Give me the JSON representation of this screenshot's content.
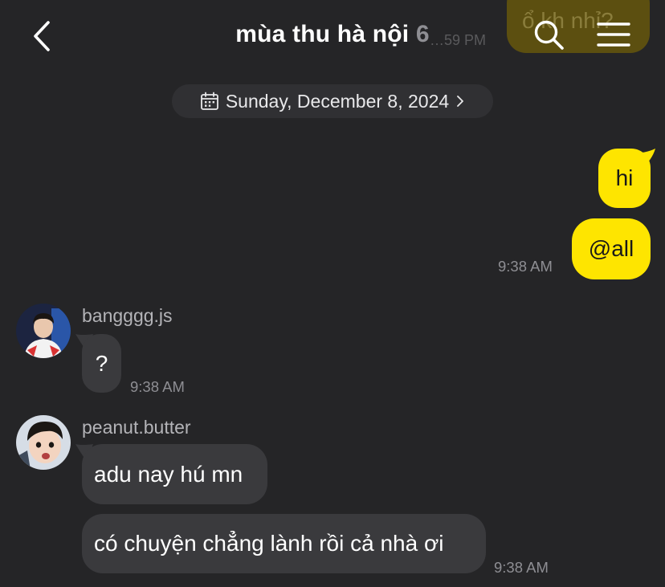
{
  "previous": {
    "text": "ổ kh nhỉ?",
    "time": "…59 PM"
  },
  "header": {
    "title": "mùa thu hà nội",
    "member_count": "6"
  },
  "date_divider": {
    "label": "Sunday, December 8, 2024"
  },
  "messages": [
    {
      "from": "me",
      "text": "hi"
    },
    {
      "from": "me",
      "text": "@all",
      "time": "9:38 AM"
    },
    {
      "from": "bangggg.js",
      "text": "?",
      "time": "9:38 AM"
    },
    {
      "from": "peanut.butter",
      "text": "adu nay hú mn"
    },
    {
      "from": "peanut.butter",
      "text": "có chuyện chẳng lành rồi cả nhà ơi",
      "time": "9:38 AM"
    }
  ],
  "colors": {
    "background": "#252527",
    "my_bubble": "#fee500",
    "their_bubble": "#3a3a3d",
    "date_pill": "#303033"
  },
  "icons": [
    "back-arrow-icon",
    "search-icon",
    "menu-icon",
    "calendar-icon",
    "chevron-right-icon"
  ]
}
